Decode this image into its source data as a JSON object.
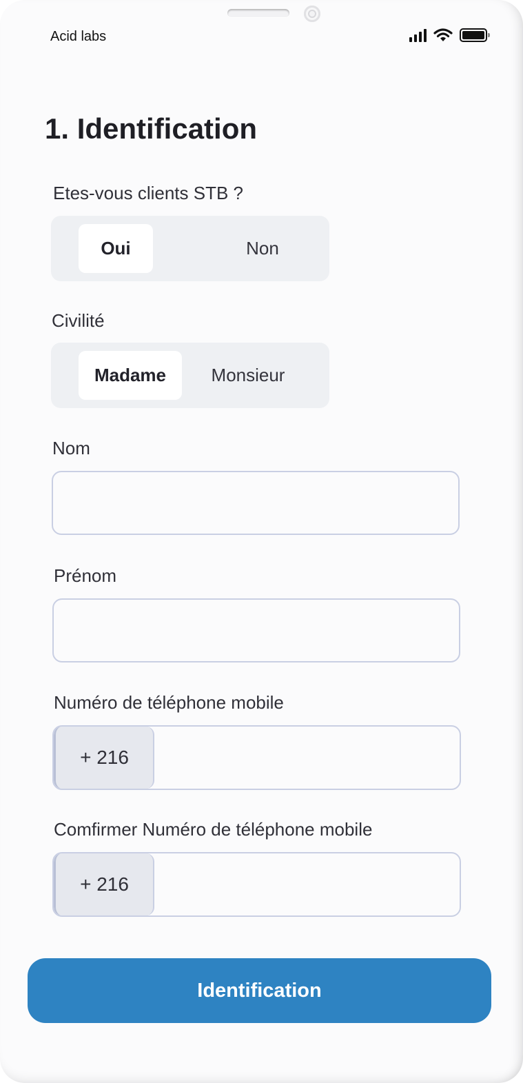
{
  "status_bar": {
    "carrier": "Acid labs",
    "icons": [
      "signal-icon",
      "wifi-icon",
      "battery-icon"
    ]
  },
  "form": {
    "title": "1. Identification",
    "client_question": {
      "label": "Etes-vous clients STB ?",
      "options": [
        "Oui",
        "Non"
      ],
      "selected": "Oui"
    },
    "civility": {
      "label": "Civilité",
      "options": [
        "Madame",
        "Monsieur"
      ],
      "selected": "Madame"
    },
    "last_name": {
      "label": "Nom",
      "value": "",
      "placeholder": ""
    },
    "first_name": {
      "label": "Prénom",
      "value": "",
      "placeholder": ""
    },
    "mobile": {
      "label": "Numéro de téléphone mobile",
      "prefix": "+ 216",
      "value": ""
    },
    "mobile_confirm": {
      "label": "Comfirmer Numéro de téléphone mobile",
      "prefix": "+ 216",
      "value": ""
    },
    "submit_label": "Identification"
  },
  "colors": {
    "accent": "#2e83c2",
    "segment_bg": "#eef0f3",
    "input_border": "#c9cfe3"
  }
}
